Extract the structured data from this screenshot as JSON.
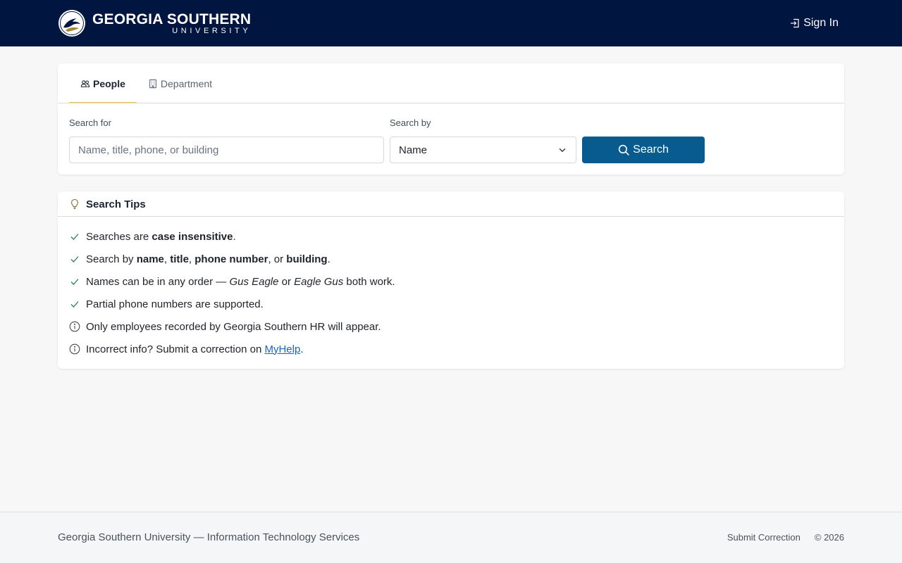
{
  "header": {
    "brand_line1": "GEORGIA SOUTHERN",
    "brand_line2": "UNIVERSITY",
    "brand_logo_icon": "eagle-seal-icon",
    "signin_label": "Sign In",
    "signin_icon": "sign-in-icon",
    "background_color": "#011541"
  },
  "search": {
    "tabs": [
      {
        "label": "People",
        "icon": "people-icon",
        "active": true
      },
      {
        "label": "Department",
        "icon": "building-icon",
        "active": false
      }
    ],
    "search_for_label": "Search for",
    "search_input_placeholder": "Name, title, phone, or building",
    "search_input_value": "",
    "search_by_label": "Search by",
    "search_by_selected": "Name",
    "search_button_label": "Search",
    "button_color": "#075b8f",
    "active_tab_underline_color": "#e5c25a"
  },
  "tips": {
    "title": "Search Tips",
    "icon": "lightbulb-icon",
    "items": [
      {
        "icon": "check-icon",
        "parts": [
          "Searches are ",
          "case insensitive",
          "."
        ]
      },
      {
        "icon": "check-icon",
        "parts": [
          "Search by ",
          "name",
          ", ",
          "title",
          ", ",
          "phone number",
          ", or ",
          "building",
          "."
        ]
      },
      {
        "icon": "check-icon",
        "parts": [
          "Names can be in any order — ",
          "Gus Eagle",
          " or ",
          "Eagle Gus",
          " both work."
        ]
      },
      {
        "icon": "check-icon",
        "parts": [
          "Partial phone numbers are supported."
        ]
      },
      {
        "icon": "info-icon",
        "parts": [
          "Only employees recorded by Georgia Southern HR will appear."
        ]
      },
      {
        "icon": "info-icon",
        "parts": [
          "Incorrect info? Submit a correction on ",
          "MyHelp",
          "."
        ]
      }
    ]
  },
  "footer": {
    "left_text": "Georgia Southern University — Information Technology Services",
    "submit_correction": "Submit Correction",
    "copyright": "© 2026"
  }
}
